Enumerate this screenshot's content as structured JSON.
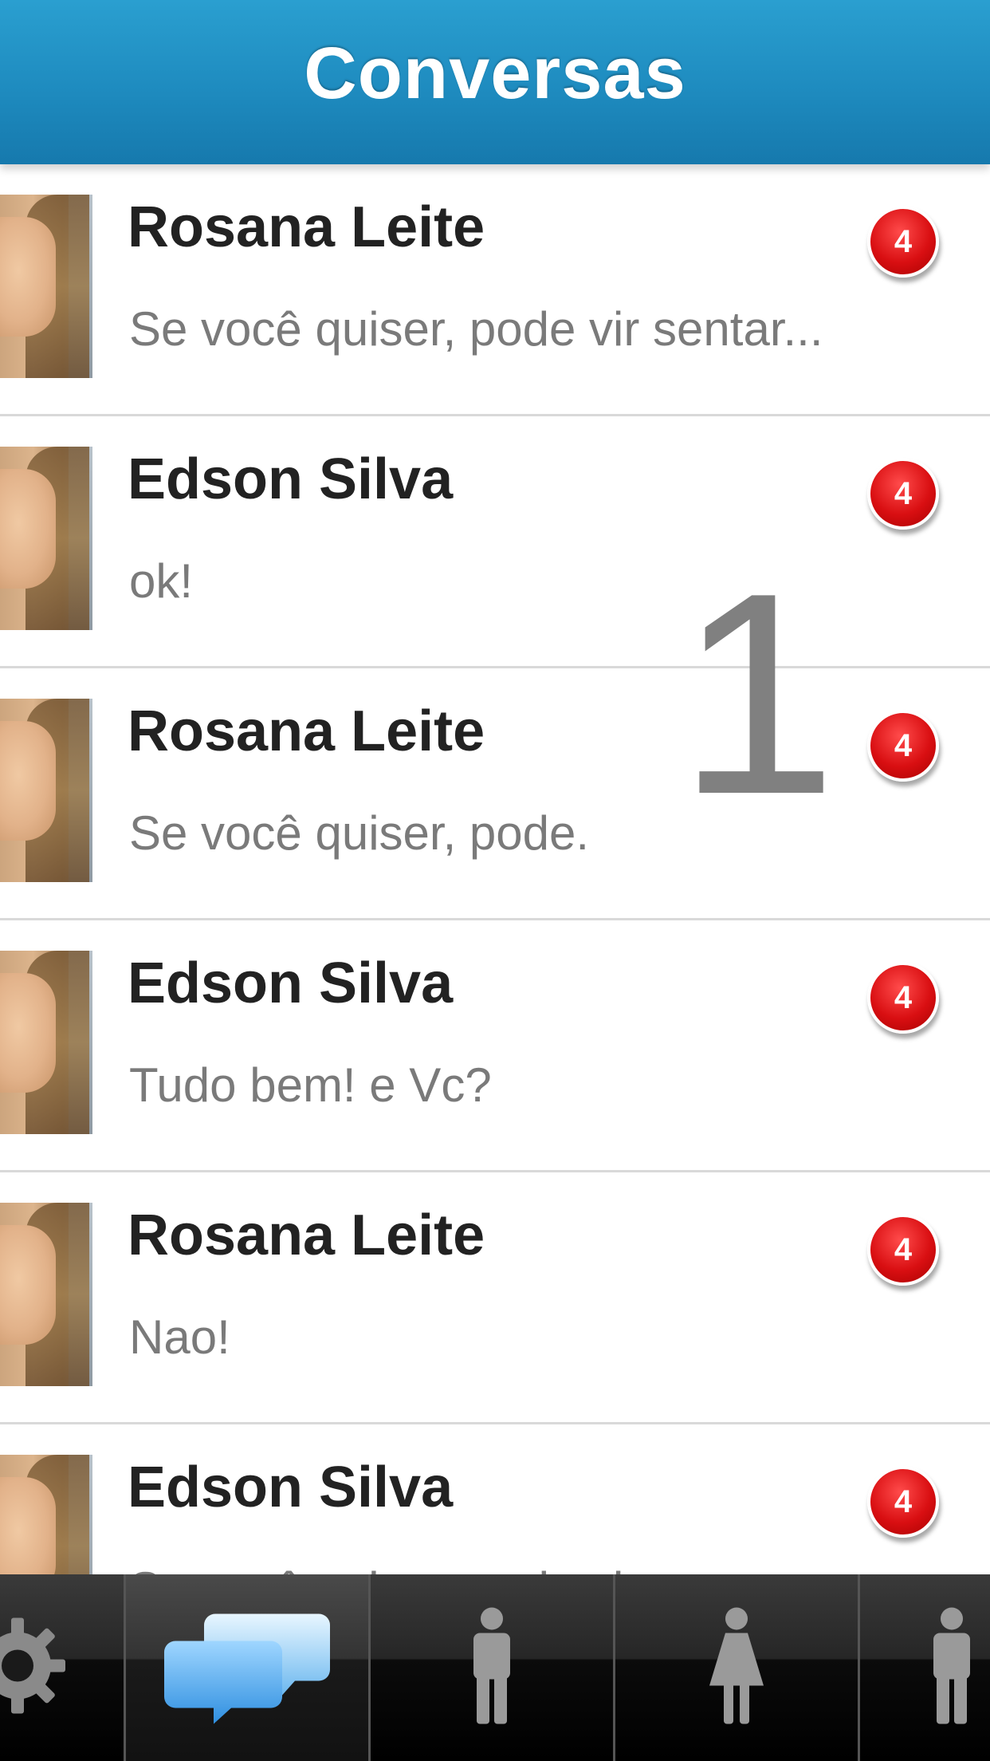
{
  "header": {
    "title": "Conversas",
    "color": "#1e8bbf"
  },
  "conversations": [
    {
      "name": "Rosana Leite",
      "preview": "Se você quiser, pode vir sentar...",
      "unread": "4"
    },
    {
      "name": "Edson Silva",
      "preview": "ok!",
      "unread": "4"
    },
    {
      "name": "Rosana Leite",
      "preview": "Se você quiser, pode.",
      "unread": "4"
    },
    {
      "name": "Edson Silva",
      "preview": "Tudo bem! e Vc?",
      "unread": "4"
    },
    {
      "name": "Rosana Leite",
      "preview": "Nao!",
      "unread": "4"
    },
    {
      "name": "Edson Silva",
      "preview": "Se você quiser, pode vir sentar...",
      "unread": "4"
    }
  ],
  "overlay": {
    "step_number": "1"
  },
  "tabbar": {
    "tabs": [
      {
        "icon": "gear-icon",
        "selected": false
      },
      {
        "icon": "chat-bubbles-icon",
        "selected": true
      },
      {
        "icon": "male-person-icon",
        "selected": false
      },
      {
        "icon": "female-person-icon",
        "selected": false
      },
      {
        "icon": "male-person-icon",
        "selected": false
      }
    ]
  },
  "colors": {
    "badge": "#d90f12",
    "name_text": "#222222",
    "preview_text": "#7a7a7a"
  }
}
